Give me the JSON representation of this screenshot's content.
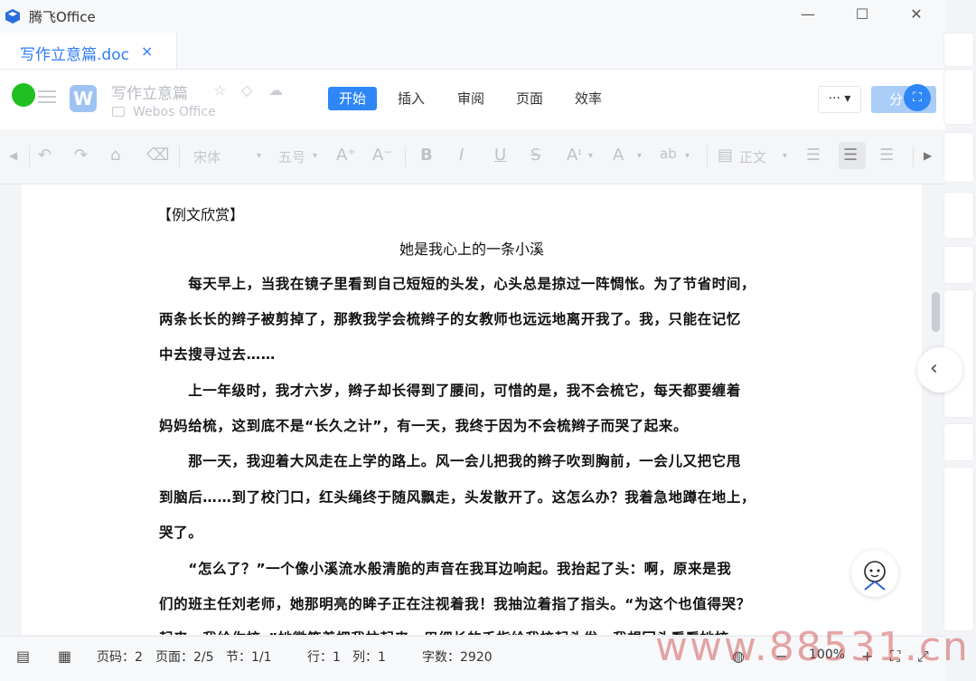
{
  "app": {
    "title": "腾飞Office"
  },
  "window": {
    "minimize": "—",
    "maximize": "☐",
    "close": "✕"
  },
  "tab": {
    "name": "写作立意篇.doc",
    "close": "×"
  },
  "header": {
    "logo_letter": "W",
    "doc_title": "写作立意篇",
    "doc_location": "Webos Office",
    "menu": [
      "开始",
      "插入",
      "审阅",
      "页面",
      "效率"
    ],
    "more": "··· ▾",
    "share": "分"
  },
  "toolbar": {
    "font": "宋体",
    "size": "五号",
    "style": "正文",
    "font_color": "#2f86f6",
    "highlight_color": "#f5e663"
  },
  "document": {
    "heading": "【例文欣赏】",
    "title": "她是我心上的一条小溪",
    "lines": [
      "　　每天早上，当我在镜子里看到自己短短的头发，心头总是掠过一阵惆怅。为了节省时间，",
      "两条长长的辫子被剪掉了，那教我学会梳辫子的女教师也远远地离开我了。我，只能在记忆",
      "中去搜寻过去……",
      "　　上一年级时，我才六岁，辫子却长得到了腰间，可惜的是，我不会梳它，每天都要缠着",
      "妈妈给梳，这到底不是“长久之计”，有一天，我终于因为不会梳辫子而哭了起来。",
      "　　那一天，我迎着大风走在上学的路上。风一会儿把我的辫子吹到胸前，一会儿又把它甩",
      "到脑后……到了校门口，红头绳终于随风飘走，头发散开了。这怎么办？我着急地蹲在地上，",
      "哭了。",
      "　　“怎么了？”一个像小溪流水般清脆的声音在我耳边响起。我抬起了头：啊，原来是我",
      "们的班主任刘老师，她那明亮的眸子正在注视着我！我抽泣着指了指头。“为这个也值得哭？",
      "起来，我给你梳。”她微笑着把我拉起来，用细长的手指给我梳起头发。我想回头看看她梳"
    ]
  },
  "status": {
    "page_code": "页码：2",
    "page": "页面：2/5",
    "section": "节：1/1",
    "row": "行：1",
    "col": "列：1",
    "words": "字数：2920",
    "zoom": "100%",
    "zoom_out": "−",
    "zoom_in": "+"
  },
  "watermark": "www.88531.cn",
  "colors": {
    "accent": "#2f86f6",
    "green": "#1fc01f"
  }
}
